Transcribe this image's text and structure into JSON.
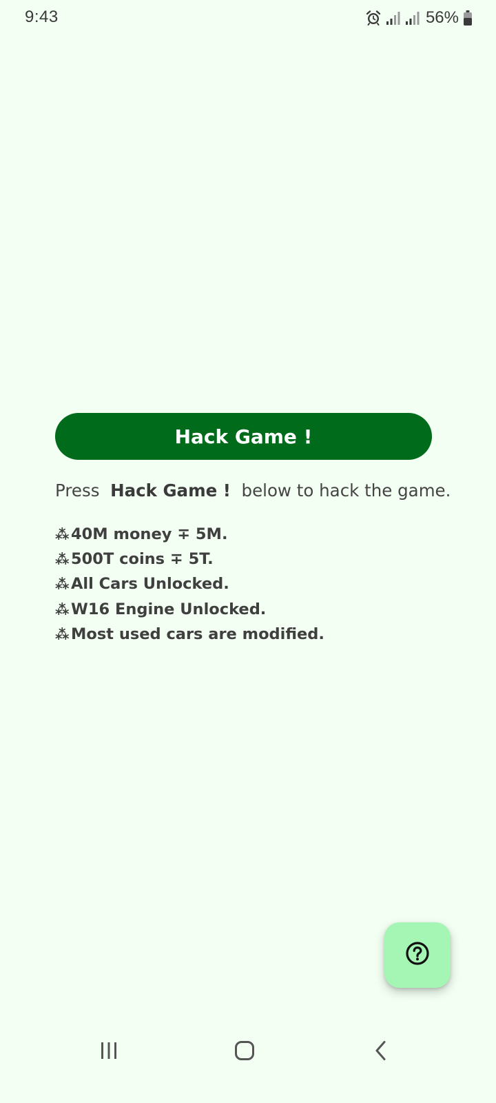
{
  "status_bar": {
    "time": "9:43",
    "battery_percent": "56%",
    "icons": [
      "alarm-icon",
      "signal-icon",
      "signal-icon",
      "battery-icon"
    ]
  },
  "main": {
    "hack_button_label": "Hack Game !",
    "instruction": {
      "prefix": "Press",
      "highlight": "Hack Game !",
      "suffix": "below to hack the game."
    },
    "bullet_symbol": "⁂",
    "features": [
      "40M money ∓ 5M.",
      "500T coins ∓ 5T.",
      "All Cars Unlocked.",
      "W16 Engine Unlocked.",
      "Most used cars are modified."
    ]
  },
  "fab": {
    "icon": "help-icon"
  },
  "nav_bar": {
    "icons": [
      "recent-apps-icon",
      "home-icon",
      "back-icon"
    ]
  },
  "colors": {
    "background": "#f3fff3",
    "primary_button": "#006b1a",
    "fab_background": "#a5f5b4",
    "text": "#3f3f3f"
  }
}
